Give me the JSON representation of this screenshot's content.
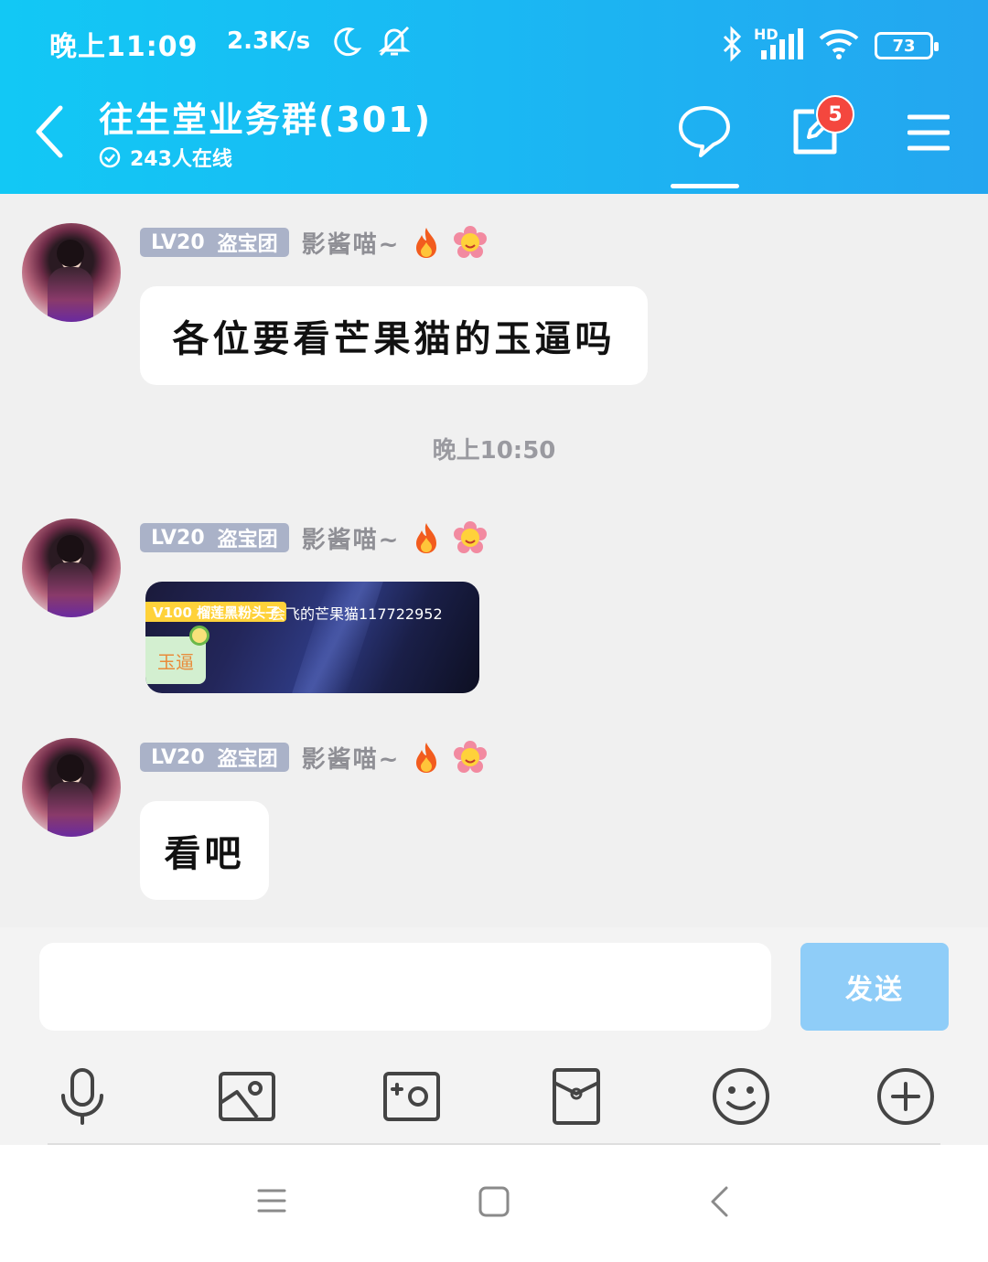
{
  "status_bar": {
    "time": "晚上11:09",
    "net_speed": "2.3K/s",
    "hd_label": "HD",
    "battery_level": "73",
    "icons": [
      "moon-icon",
      "bell-off-icon",
      "bluetooth-icon",
      "signal-icon",
      "wifi-icon",
      "battery-icon"
    ]
  },
  "header": {
    "title": "往生堂业务群(301)",
    "online": "243人在线",
    "notification_count": "5",
    "icons": [
      "back-icon",
      "online-check-icon",
      "chat-bubble-icon",
      "edit-icon",
      "menu-icon"
    ]
  },
  "messages": [
    {
      "level": "LV20",
      "title": "盗宝团",
      "sender": "影酱喵~",
      "text": "各位要看芒果猫的玉逼吗"
    },
    {
      "level": "LV20",
      "title": "盗宝团",
      "sender": "影酱喵~",
      "image": {
        "tag": "V100 榴莲黑粉头子",
        "name": "会飞的芒果猫117722952",
        "box_text": "玉逼"
      }
    },
    {
      "level": "LV20",
      "title": "盗宝团",
      "sender": "影酱喵~",
      "text": "看吧"
    }
  ],
  "timestamp": "晚上10:50",
  "input": {
    "placeholder": "",
    "send_label": "发送"
  },
  "toolbar": [
    "microphone-icon",
    "image-icon",
    "camera-icon",
    "red-packet-icon",
    "emoji-icon",
    "plus-icon"
  ],
  "nav": [
    "recent-apps-icon",
    "home-icon",
    "back-nav-icon"
  ],
  "colors": {
    "header_gradient_start": "#12c8f5",
    "header_gradient_end": "#24a6f0",
    "send_button": "#8fcdf8",
    "badge": "#f4473e",
    "level_badge": "#aab2c8",
    "background": "#f0f0f0"
  }
}
